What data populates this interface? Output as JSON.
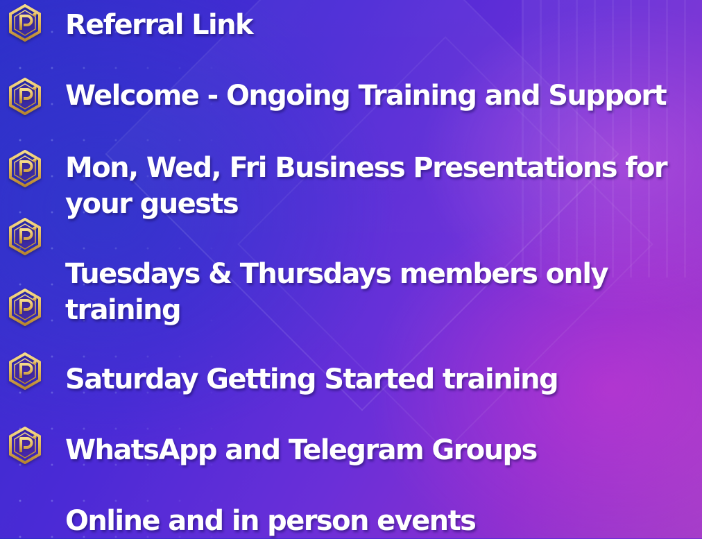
{
  "items": [
    {
      "label": "Referral Link"
    },
    {
      "label": "Welcome - Ongoing Training and Support"
    },
    {
      "label": "Mon, Wed, Fri Business Presentations for",
      "label2": "your guests"
    },
    {
      "label": "Tuesdays & Thursdays members only",
      "label2": "training"
    },
    {
      "label": "Saturday Getting Started training"
    },
    {
      "label": "WhatsApp and Telegram Groups"
    },
    {
      "label": "Online and in person events"
    }
  ],
  "icon": {
    "name": "p-hexagon-logo-icon",
    "glyph": "P",
    "color": "#e2b65a"
  },
  "colors": {
    "text": "#ffffff",
    "background": "#4b2ad6",
    "accent": "#e2b65a"
  }
}
